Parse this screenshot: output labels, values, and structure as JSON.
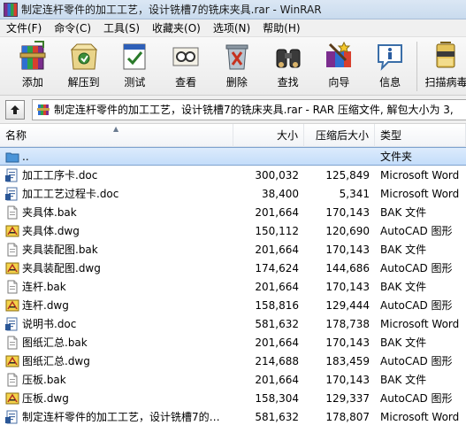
{
  "window": {
    "title": "制定连杆零件的加工工艺，设计铣槽7的铣床夹具.rar - WinRAR"
  },
  "menu": [
    "文件(F)",
    "命令(C)",
    "工具(S)",
    "收藏夹(O)",
    "选项(N)",
    "帮助(H)"
  ],
  "toolbar": [
    {
      "label": "添加",
      "icon": "add-icon"
    },
    {
      "label": "解压到",
      "icon": "extract-icon"
    },
    {
      "label": "测试",
      "icon": "test-icon"
    },
    {
      "label": "查看",
      "icon": "view-icon"
    },
    {
      "label": "删除",
      "icon": "delete-icon"
    },
    {
      "label": "查找",
      "icon": "find-icon"
    },
    {
      "label": "向导",
      "icon": "wizard-icon"
    },
    {
      "label": "信息",
      "icon": "info-icon"
    },
    {
      "label": "扫描病毒",
      "icon": "virus-scan-icon"
    }
  ],
  "address": {
    "text": "制定连杆零件的加工工艺，设计铣槽7的铣床夹具.rar - RAR 压缩文件, 解包大小为 3,"
  },
  "columns": {
    "name": "名称",
    "size": "大小",
    "packed": "压缩后大小",
    "type": "类型"
  },
  "parent_row": {
    "name": "..",
    "type": "文件夹"
  },
  "files": [
    {
      "name": "加工工序卡.doc",
      "size": "300,032",
      "packed": "125,849",
      "type": "Microsoft Word",
      "icon": "word"
    },
    {
      "name": "加工工艺过程卡.doc",
      "size": "38,400",
      "packed": "5,341",
      "type": "Microsoft Word",
      "icon": "word"
    },
    {
      "name": "夹具体.bak",
      "size": "201,664",
      "packed": "170,143",
      "type": "BAK 文件",
      "icon": "bak"
    },
    {
      "name": "夹具体.dwg",
      "size": "150,112",
      "packed": "120,690",
      "type": "AutoCAD 图形",
      "icon": "dwg"
    },
    {
      "name": "夹具装配图.bak",
      "size": "201,664",
      "packed": "170,143",
      "type": "BAK 文件",
      "icon": "bak"
    },
    {
      "name": "夹具装配图.dwg",
      "size": "174,624",
      "packed": "144,686",
      "type": "AutoCAD 图形",
      "icon": "dwg"
    },
    {
      "name": "连杆.bak",
      "size": "201,664",
      "packed": "170,143",
      "type": "BAK 文件",
      "icon": "bak"
    },
    {
      "name": "连杆.dwg",
      "size": "158,816",
      "packed": "129,444",
      "type": "AutoCAD 图形",
      "icon": "dwg"
    },
    {
      "name": "说明书.doc",
      "size": "581,632",
      "packed": "178,738",
      "type": "Microsoft Word",
      "icon": "word"
    },
    {
      "name": "图纸汇总.bak",
      "size": "201,664",
      "packed": "170,143",
      "type": "BAK 文件",
      "icon": "bak"
    },
    {
      "name": "图纸汇总.dwg",
      "size": "214,688",
      "packed": "183,459",
      "type": "AutoCAD 图形",
      "icon": "dwg"
    },
    {
      "name": "压板.bak",
      "size": "201,664",
      "packed": "170,143",
      "type": "BAK 文件",
      "icon": "bak"
    },
    {
      "name": "压板.dwg",
      "size": "158,304",
      "packed": "129,337",
      "type": "AutoCAD 图形",
      "icon": "dwg"
    },
    {
      "name": "制定连杆零件的加工工艺，设计铣槽7的铣...",
      "size": "581,632",
      "packed": "178,807",
      "type": "Microsoft Word",
      "icon": "word"
    }
  ]
}
